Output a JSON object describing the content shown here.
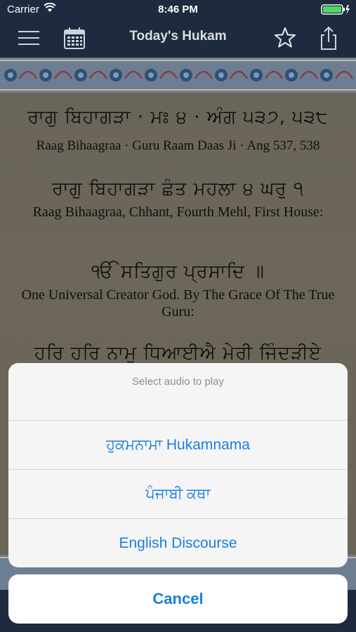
{
  "status_bar": {
    "carrier": "Carrier",
    "time": "8:46 PM"
  },
  "nav": {
    "title": "Today's Hukam",
    "icons": [
      "menu-icon",
      "calendar-icon",
      "star-icon",
      "share-icon"
    ]
  },
  "hukam": {
    "line1_gurmukhi": "ਰਾਗੁ ਬਿਹਾਗੜਾ · ਮਃ ੪ · ਅੰਗ ੫੩੭, ੫੩੮",
    "line1_translit": "Raag Bihaagraa · Guru Raam Daas Ji · Ang 537, 538",
    "line2_gurmukhi": "ਰਾਗੁ ਬਿਹਾਗੜਾ ਛੰਤ ਮਹਲਾ ੪ ਘਰੁ ੧",
    "line2_translit": "Raag Bihaagraa, Chhant, Fourth Mehl, First House:",
    "line3_gurmukhi": "ੴ ਸਤਿਗੁਰ ਪ੍ਰਸਾਦਿ ॥",
    "line3_translit": "One Universal Creator God. By The Grace Of The True Guru:",
    "line4_gurmukhi": "ਹਰਿ ਹਰਿ ਨਾਮੁ ਧਿਆਈਐ ਮੇਰੀ ਜਿੰਦੜੀਏ ਗੁਰਮੁਖਿ"
  },
  "action_sheet": {
    "heading": "Select audio to play",
    "options": [
      "ਹੁਕਮਨਾਮਾ Hukamnama",
      "ਪੰਜਾਬੀ ਕਥਾ",
      "English Discourse"
    ],
    "cancel": "Cancel"
  },
  "colors": {
    "nav_bg": "#1e2b3e",
    "accent": "#1a7fe0",
    "parchment": "#6b6558"
  }
}
